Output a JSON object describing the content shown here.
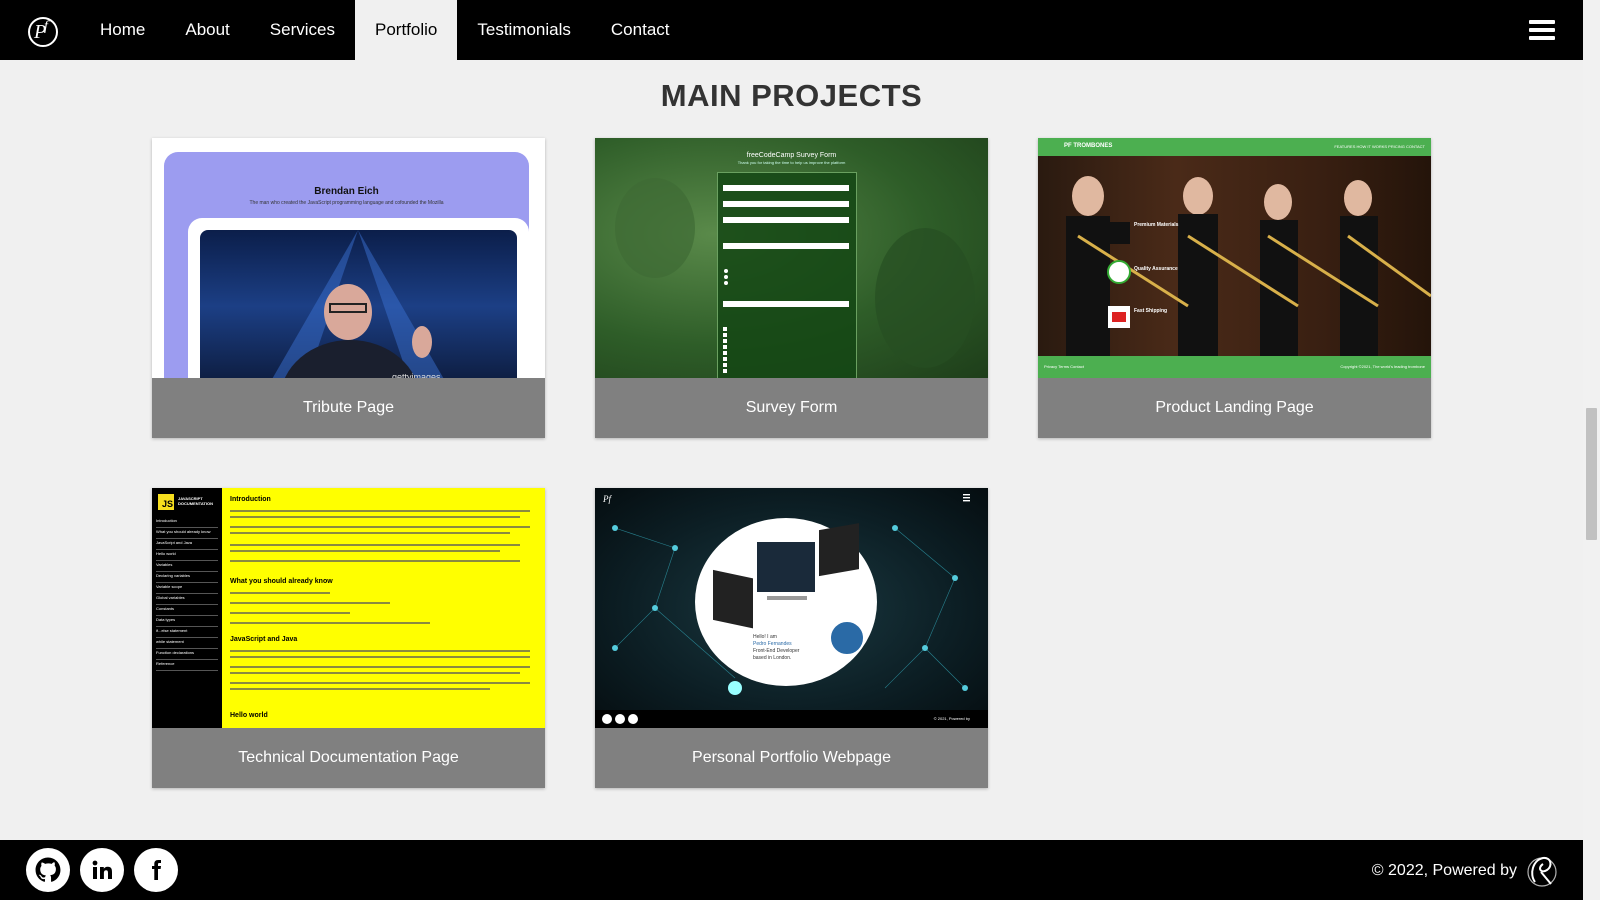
{
  "navbar": {
    "logo_alt": "PF logo",
    "links": [
      {
        "label": "Home"
      },
      {
        "label": "About"
      },
      {
        "label": "Services"
      },
      {
        "label": "Portfolio",
        "active": true
      },
      {
        "label": "Testimonials"
      },
      {
        "label": "Contact"
      }
    ],
    "menu_icon": "hamburger-icon"
  },
  "main": {
    "heading": "MAIN PROJECTS",
    "projects": [
      {
        "label": "Tribute Page",
        "thumb_title": "Brendan Eich",
        "thumb_subtitle": "The man who created the JavaScript programming language and cofounded the Mozilla",
        "thumb_credit": "gettyimages"
      },
      {
        "label": "Survey Form",
        "thumb_title": "freeCodeCamp Survey Form",
        "thumb_subtitle": "Thank you for taking the time to help us improve the platform"
      },
      {
        "label": "Product Landing Page",
        "thumb_brand": "PF TROMBONES",
        "thumb_nav": "FEATURES   HOW IT WORKS   PRICING   CONTACT",
        "thumb_features": [
          "Premium Materials",
          "Quality Assurance",
          "Fast Shipping"
        ],
        "thumb_footer": "Privacy   Terms   Contact",
        "thumb_copy": "Copyright ©2021, The world's leading trombone"
      },
      {
        "label": "Technical Documentation Page",
        "thumb_badge": "JS",
        "thumb_brand": "JAVASCRIPT DOCUMENTATION",
        "thumb_nav": [
          "Introduction",
          "What you should already know",
          "JavaScript and Java",
          "Hello world",
          "Variables",
          "Declaring variables",
          "Variable scope",
          "Global variables",
          "Constants",
          "Data types",
          "if...else statement",
          "while statement",
          "Function declarations",
          "Reference"
        ],
        "thumb_headings": [
          "Introduction",
          "What you should already know",
          "JavaScript and Java",
          "Hello world"
        ]
      },
      {
        "label": "Personal Portfolio Webpage",
        "thumb_greeting": "Hello! I am",
        "thumb_name": "Pedro Fernandes",
        "thumb_role": "Front-End Developer",
        "thumb_location": "based in London.",
        "thumb_footer": "© 2021, Powered by"
      }
    ]
  },
  "footer": {
    "social": [
      {
        "icon": "github-icon"
      },
      {
        "icon": "linkedin-icon"
      },
      {
        "icon": "facebook-icon"
      }
    ],
    "copyright": "© 2022, Powered by"
  }
}
